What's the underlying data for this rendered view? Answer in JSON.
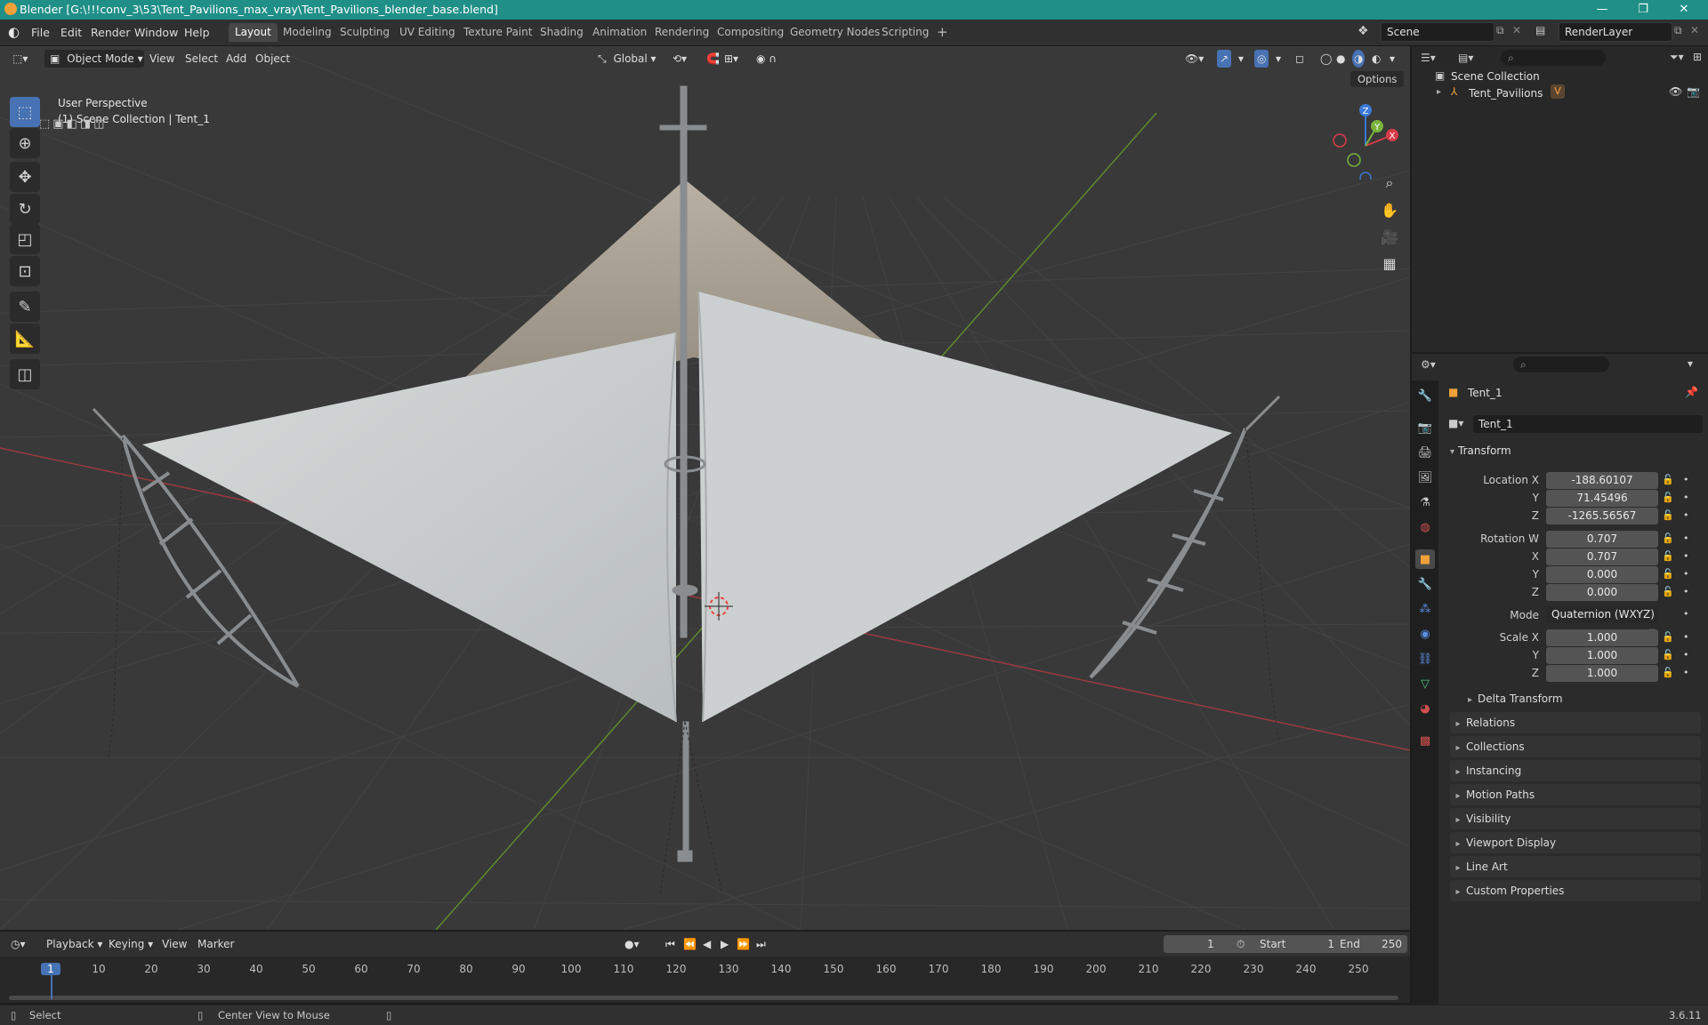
{
  "window": {
    "title": "Blender [G:\\!!!conv_3\\53\\Tent_Pavilions_max_vray\\Tent_Pavilions_blender_base.blend]",
    "minimize": "—",
    "maximize": "❐",
    "close": "✕"
  },
  "menu": [
    "File",
    "Edit",
    "Render",
    "Window",
    "Help"
  ],
  "workspaces": [
    "Layout",
    "Modeling",
    "Sculpting",
    "UV Editing",
    "Texture Paint",
    "Shading",
    "Animation",
    "Rendering",
    "Compositing",
    "Geometry Nodes",
    "Scripting"
  ],
  "workspace_add": "+",
  "scene": {
    "name": "Scene"
  },
  "render_layer": {
    "name": "RenderLayer"
  },
  "viewport": {
    "mode": "Object Mode",
    "menus": [
      "View",
      "Select",
      "Add",
      "Object"
    ],
    "orientation": "Global",
    "options_label": "Options",
    "overlay_title": "User Perspective",
    "overlay_subtitle": "(1) Scene Collection | Tent_1",
    "gizmo": {
      "x": "X",
      "y": "Y",
      "z": "Z"
    }
  },
  "outliner": {
    "root": "Scene Collection",
    "items": [
      {
        "name": "Tent_Pavilions"
      }
    ]
  },
  "properties": {
    "object_name": "Tent_1",
    "data_name": "Tent_1",
    "transform_label": "Transform",
    "location": {
      "label": "Location X",
      "x": "-188.60107",
      "y": "71.45496",
      "z": "-1265.56567"
    },
    "rotation": {
      "label": "Rotation W",
      "w": "0.707",
      "x": "0.707",
      "y": "0.000",
      "z": "0.000"
    },
    "axis_labels": {
      "x": "X",
      "y": "Y",
      "z": "Z"
    },
    "mode": {
      "label": "Mode",
      "value": "Quaternion (WXYZ)"
    },
    "scale": {
      "label": "Scale X",
      "x": "1.000",
      "y": "1.000",
      "z": "1.000"
    },
    "delta_transform": "Delta Transform",
    "panels": [
      "Relations",
      "Collections",
      "Instancing",
      "Motion Paths",
      "Visibility",
      "Viewport Display",
      "Line Art",
      "Custom Properties"
    ]
  },
  "timeline": {
    "menus": [
      "Playback",
      "Keying",
      "View",
      "Marker"
    ],
    "current_frame": "1",
    "start_label": "Start",
    "start": "1",
    "end_label": "End",
    "end": "250",
    "ticks": [
      "1",
      "10",
      "20",
      "30",
      "40",
      "50",
      "60",
      "70",
      "80",
      "90",
      "100",
      "110",
      "120",
      "130",
      "140",
      "150",
      "160",
      "170",
      "180",
      "190",
      "200",
      "210",
      "220",
      "230",
      "240",
      "250"
    ]
  },
  "status": {
    "select": "Select",
    "center_view": "Center View to Mouse",
    "version": "3.6.11"
  },
  "colors": {
    "accent": "#4772b3",
    "titlebar": "#1f8f88",
    "x_axis": "#d93b48",
    "y_axis": "#7ab33c",
    "z_axis": "#3b78d9"
  }
}
